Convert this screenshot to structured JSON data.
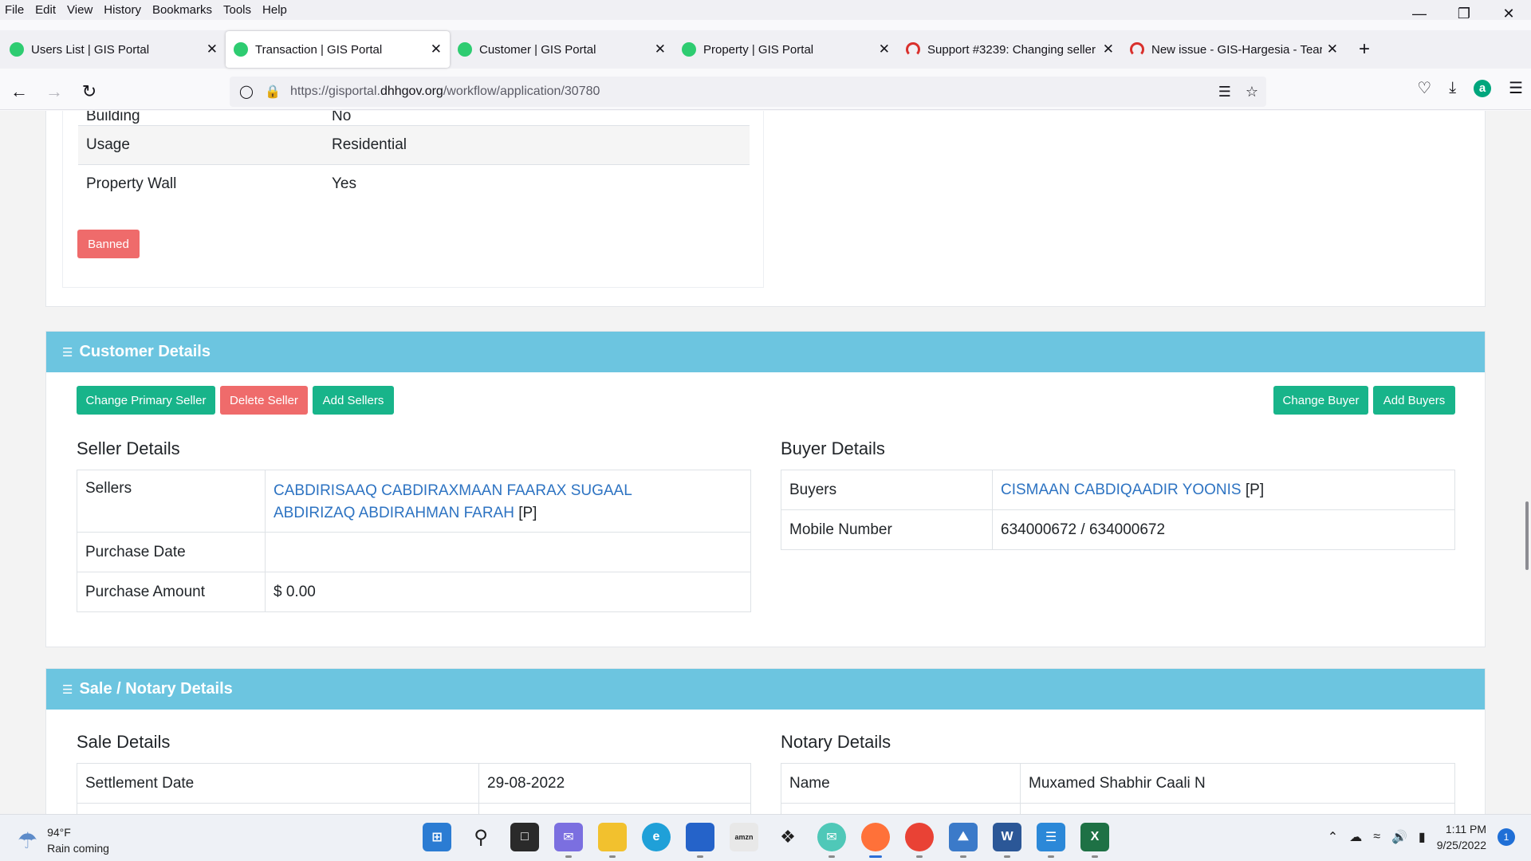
{
  "menu": [
    "File",
    "Edit",
    "View",
    "History",
    "Bookmarks",
    "Tools",
    "Help"
  ],
  "tabs": [
    {
      "label": "Users List | GIS Portal",
      "favicon": "gis-portal-icon",
      "active": false
    },
    {
      "label": "Transaction | GIS Portal",
      "favicon": "gis-portal-icon",
      "active": true
    },
    {
      "label": "Customer | GIS Portal",
      "favicon": "gis-portal-icon",
      "active": false
    },
    {
      "label": "Property | GIS Portal",
      "favicon": "gis-portal-icon",
      "active": false
    },
    {
      "label": "Support #3239: Changing seller",
      "favicon": "redmine-icon",
      "active": false
    },
    {
      "label": "New issue - GIS-Hargesia - Tear",
      "favicon": "redmine-icon",
      "active": false
    }
  ],
  "url": {
    "prefix": "https://gisportal.",
    "host": "dhhgov.org",
    "path": "/workflow/application/30780"
  },
  "property": {
    "rows": [
      {
        "label": "Building",
        "value": "No"
      },
      {
        "label": "Usage",
        "value": "Residential"
      },
      {
        "label": "Property Wall",
        "value": "Yes"
      }
    ],
    "banned_label": "Banned"
  },
  "customer": {
    "header": "Customer Details",
    "buttons": {
      "change_primary_seller": "Change Primary Seller",
      "delete_seller": "Delete Seller",
      "add_sellers": "Add Sellers",
      "change_buyer": "Change Buyer",
      "add_buyers": "Add Buyers"
    },
    "seller_title": "Seller Details",
    "seller": {
      "sellers_label": "Sellers",
      "seller1": "CABDIRISAAQ CABDIRAXMAAN FAARAX SUGAAL",
      "seller2": "ABDIRIZAQ ABDIRAHMAN FARAH",
      "seller2_tag": "[P]",
      "purchase_date_label": "Purchase Date",
      "purchase_date": "",
      "purchase_amount_label": "Purchase Amount",
      "purchase_amount": "$ 0.00"
    },
    "buyer_title": "Buyer Details",
    "buyer": {
      "buyers_label": "Buyers",
      "buyer1": "CISMAAN CABDIQAADIR YOONIS",
      "buyer1_tag": "[P]",
      "mobile_label": "Mobile Number",
      "mobile": "634000672 / 634000672"
    }
  },
  "sale": {
    "header": "Sale / Notary Details",
    "sale_title": "Sale Details",
    "settlement_label": "Settlement Date",
    "settlement_date": "29-08-2022",
    "notary_title": "Notary Details",
    "name_label": "Name",
    "name_value": "Muxamed Shabhir Caali N"
  },
  "taskbar": {
    "temp": "94°F",
    "weather": "Rain coming",
    "time": "1:11 PM",
    "date": "9/25/2022",
    "notifications": "1"
  },
  "colors": {
    "header": "#6cc5e0",
    "green": "#18b48a",
    "red": "#ef6b6b",
    "link": "#2d73c2"
  }
}
